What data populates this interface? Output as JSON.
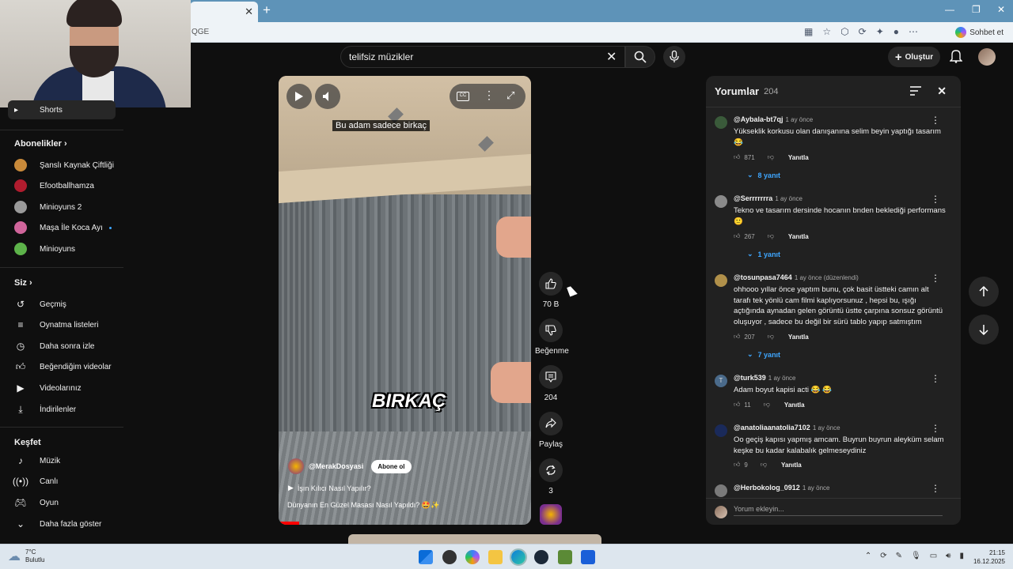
{
  "browser": {
    "tab_close": "✕",
    "new_tab": "+",
    "address_fragment": "QGE",
    "chat_label": "Sohbet et",
    "window_controls": [
      "—",
      "❐",
      "✕"
    ]
  },
  "search": {
    "query": "telifsiz müzikler",
    "clear": "✕"
  },
  "header": {
    "create_label": "Oluştur"
  },
  "sidebar": {
    "shorts_label": "Shorts",
    "subscriptions_heading": "Abonelikler",
    "subscriptions": [
      {
        "label": "Şanslı Kaynak Çiftliği",
        "color": "#c98a3a"
      },
      {
        "label": "Efootballhamza",
        "color": "#b01c2e"
      },
      {
        "label": "Minioyuns 2",
        "color": "#9a9a9a"
      },
      {
        "label": "Maşa İle Koca Ayı",
        "color": "#d0659b"
      },
      {
        "label": "Minioyuns",
        "color": "#5db34a"
      }
    ],
    "you_heading": "Siz",
    "you_items": [
      {
        "label": "Geçmiş",
        "icon": "history-icon"
      },
      {
        "label": "Oynatma listeleri",
        "icon": "playlist-icon"
      },
      {
        "label": "Daha sonra izle",
        "icon": "clock-icon"
      },
      {
        "label": "Beğendiğim videolar",
        "icon": "thumbs-up-icon"
      },
      {
        "label": "Videolarınız",
        "icon": "video-icon"
      },
      {
        "label": "İndirilenler",
        "icon": "download-icon"
      }
    ],
    "explore_heading": "Keşfet",
    "explore_items": [
      {
        "label": "Müzik",
        "icon": "music-icon"
      },
      {
        "label": "Canlı",
        "icon": "live-icon"
      },
      {
        "label": "Oyun",
        "icon": "gamepad-icon"
      },
      {
        "label": "Daha fazla göster",
        "icon": "chevron-down-icon"
      }
    ]
  },
  "video": {
    "caption": "Bu adam sadece birkaç",
    "overlay_text": "BIRKAÇ",
    "channel": "@MerakDosyasi",
    "subscribe_label": "Abone ol",
    "sound_label": "İşın Kılıcı Nasıl Yapılır?",
    "title": "Dünyanın En Güzel Masası Nasıl Yapıldı? 🤩✨",
    "progress": 0.08
  },
  "actions": {
    "likes": "70 B",
    "dislike_label": "Beğenme",
    "comments": "204",
    "share_label": "Paylaş",
    "remix": "3"
  },
  "comments": {
    "heading": "Yorumlar",
    "count": "204",
    "input_placeholder": "Yorum ekleyin...",
    "reply_label": "Yanıtla",
    "items": [
      {
        "user": "@Aybala-bt7qj",
        "time": "1 ay önce",
        "text": "Yükseklik korkusu olan danışanına selim beyin yaptığı tasarım 😂",
        "likes": "871",
        "replies": "8 yanıt",
        "color": "#3a5a3a"
      },
      {
        "user": "@Serrrrrrra",
        "time": "1 ay önce",
        "text": "Tekno ve tasarım dersinde hocanın bnden beklediği performans 🙂",
        "likes": "267",
        "replies": "1 yanıt",
        "color": "#8a8a8a"
      },
      {
        "user": "@tosunpasa7464",
        "time": "1 ay önce (düzenlendi)",
        "text": "ohhooo yıllar önce yaptım bunu, çok basit üstteki camın alt tarafı tek yönlü cam filmi kaplıyorsunuz , hepsi bu, ışığı açtığında aynadan gelen görüntü üstte çarpına sonsuz görüntü oluşuyor , sadece bu değil bir sürü tablo yapıp satmıştım",
        "likes": "207",
        "replies": "7 yanıt",
        "color": "#b0904a"
      },
      {
        "user": "@turk539",
        "time": "1 ay önce",
        "text": "Adam boyut kapisi acti 😂 😂",
        "likes": "11",
        "replies": "",
        "color": "#4a6a8a"
      },
      {
        "user": "@anatoliaanatolia7102",
        "time": "1 ay önce",
        "text": "Oo geçiş kapısı yapmış amcam. Buyrun buyrun aleyküm selam keşke bu kadar kalabalık gelmeseydiniz",
        "likes": "9",
        "replies": "",
        "color": "#1a2a5a"
      },
      {
        "user": "@Herbokolog_0912",
        "time": "1 ay önce",
        "text": "",
        "likes": "",
        "replies": "",
        "color": "#7a7a7a"
      }
    ]
  },
  "taskbar": {
    "temperature": "7°C",
    "weather": "Bulutlu",
    "time": "21:15",
    "date": "16.12.2025"
  }
}
